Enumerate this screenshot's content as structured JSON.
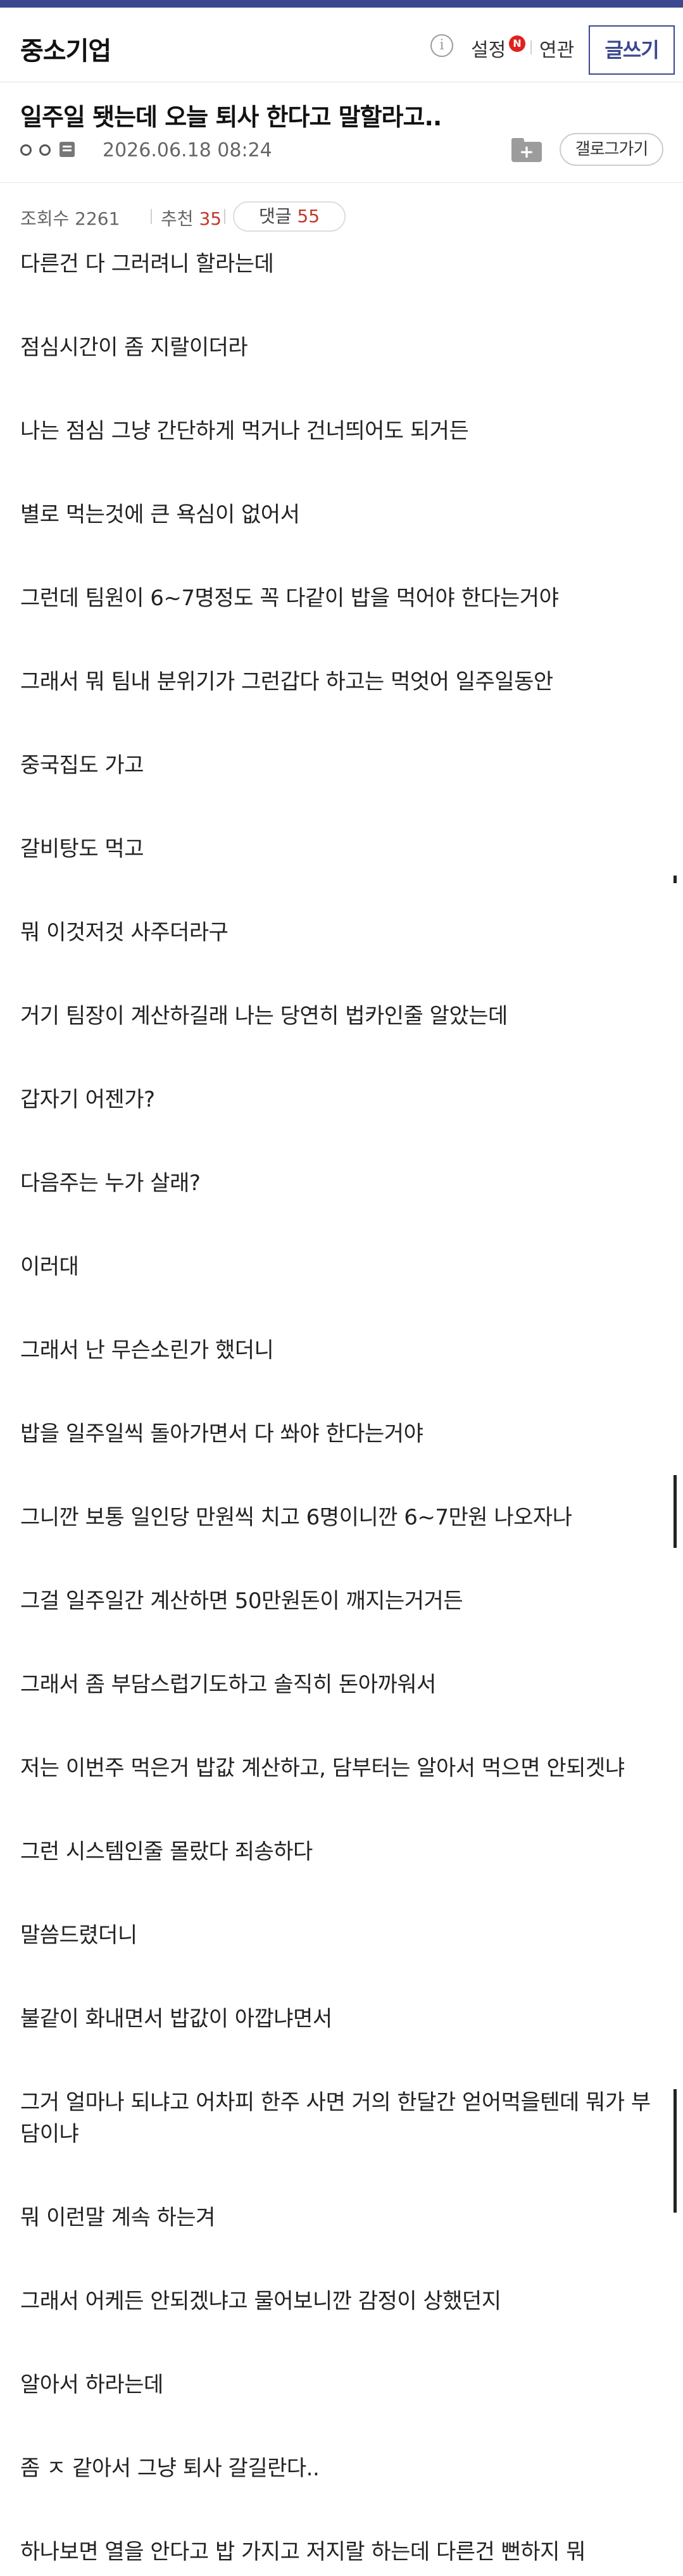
{
  "header": {
    "gallery_title": "중소기업",
    "info_icon_glyph": "i",
    "settings_label": "설정",
    "settings_badge": "N",
    "related_label": "연관",
    "write_label": "글쓰기"
  },
  "post": {
    "title": "일주일 됏는데 오늘 퇴사 한다고 말할라고..",
    "date": "2026.06.18 08:24",
    "folder_plus": "+",
    "blog_label": "갤로그가기"
  },
  "stats": {
    "views_label": "조회수 2261",
    "recommend_label": "추천",
    "recommend_count": "35",
    "comments_label": "댓글",
    "comments_count": "55"
  },
  "body": {
    "paragraphs": [
      "다른건 다 그러려니 할라는데",
      "점심시간이 좀 지랄이더라",
      "나는 점심 그냥 간단하게 먹거나 건너띄어도 되거든",
      "별로 먹는것에 큰 욕심이 없어서",
      "그런데 팀원이 6~7명정도  꼭 다같이 밥을 먹어야 한다는거야",
      "그래서 뭐 팀내 분위기가 그런갑다 하고는 먹엇어 일주일동안",
      "중국집도 가고",
      "갈비탕도 먹고",
      "뭐 이것저것 사주더라구",
      "거기 팀장이 계산하길래 나는 당연히 법카인줄 알았는데",
      "갑자기 어젠가?",
      "다음주는 누가 살래?",
      "이러대",
      "그래서 난 무슨소린가 했더니",
      "밥을 일주일씩 돌아가면서 다 쏴야 한다는거야",
      "그니깐 보통 일인당 만원씩 치고 6명이니깐 6~7만원 나오자나",
      "그걸 일주일간 계산하면 50만원돈이 깨지는거거든",
      "그래서 좀 부담스럽기도하고 솔직히 돈아까워서",
      "저는 이번주 먹은거 밥값 계산하고, 담부터는 알아서 먹으면 안되겟냐",
      "그런 시스템인줄 몰랐다 죄송하다",
      "말씀드렸더니",
      "불같이 화내면서 밥값이 아깝냐면서",
      "그거 얼마나 되냐고 어차피 한주 사면 거의 한달간 얻어먹을텐데 뭐가 부담이냐",
      "뭐 이런말 계속 하는겨",
      "그래서 어케든 안되겠냐고 물어보니깐 감정이 상했던지",
      "알아서 하라는데",
      "좀 ㅈ 같아서 그냥 퇴사 갈길란다..",
      "하나보면 열을 안다고 밥 가지고 저지랄 하는데 다른건 뻔하지 뭐"
    ]
  }
}
